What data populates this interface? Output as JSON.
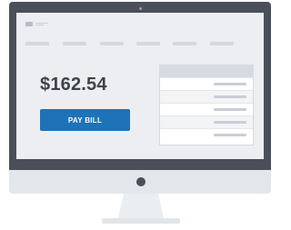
{
  "billing": {
    "amount": "$162.54",
    "pay_button_label": "PAY BILL"
  },
  "colors": {
    "bezel": "#4a4f5a",
    "screen_background": "#eceef1",
    "primary_button": "#1e73b8",
    "amount_text": "#3d434d"
  },
  "icons": {
    "logo": "logo-icon",
    "camera": "camera-icon",
    "power": "power-button-icon"
  }
}
